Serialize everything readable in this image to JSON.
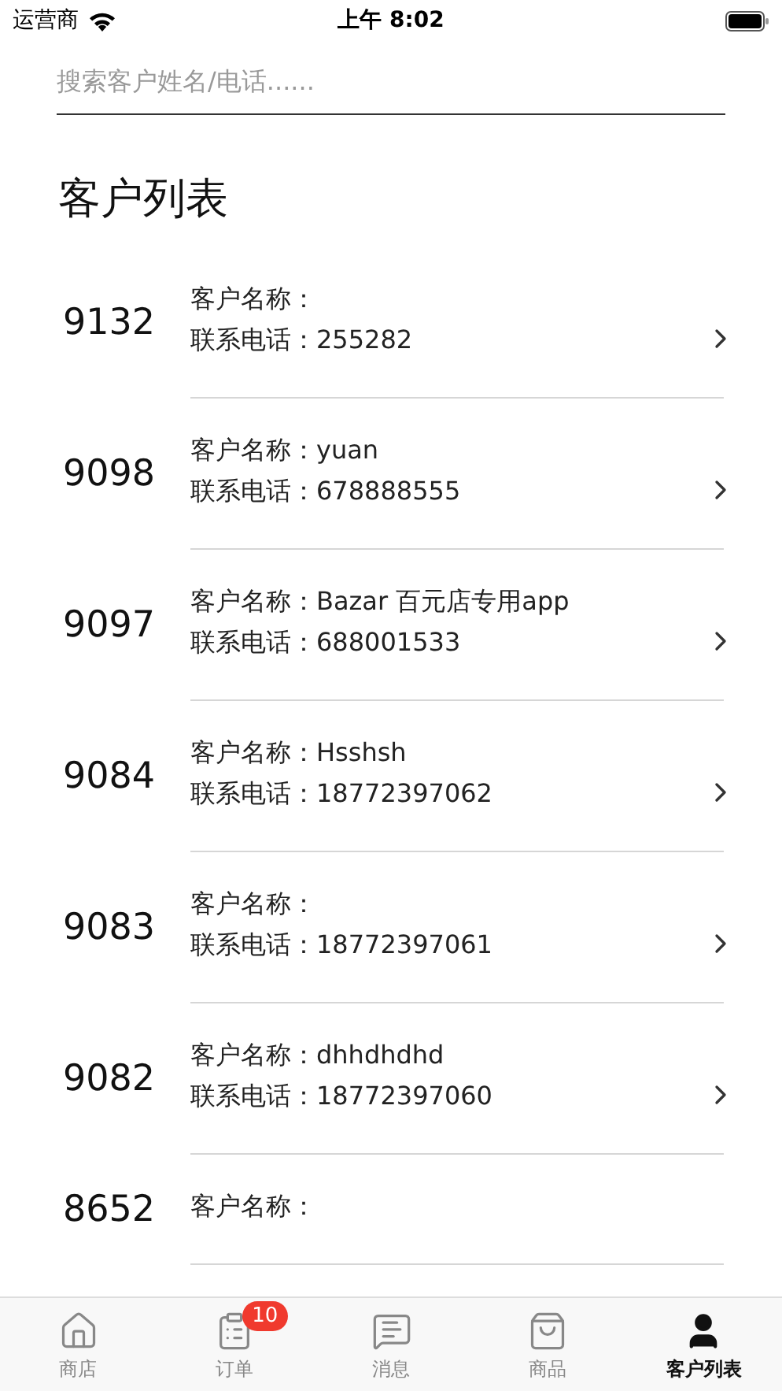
{
  "status_bar": {
    "carrier": "运营商",
    "time": "上午 8:02"
  },
  "search": {
    "placeholder": "搜索客户姓名/电话......"
  },
  "title": "客户列表",
  "customers": [
    {
      "id": "9132",
      "name_line": "客户名称：",
      "phone_line": "联系电话：255282"
    },
    {
      "id": "9098",
      "name_line": "客户名称：yuan",
      "phone_line": "联系电话：678888555"
    },
    {
      "id": "9097",
      "name_line": "客户名称：Bazar 百元店专用app",
      "phone_line": "联系电话：688001533"
    },
    {
      "id": "9084",
      "name_line": "客户名称：Hsshsh",
      "phone_line": "联系电话：18772397062"
    },
    {
      "id": "9083",
      "name_line": "客户名称：",
      "phone_line": "联系电话：18772397061"
    },
    {
      "id": "9082",
      "name_line": "客户名称：dhhdhdhd",
      "phone_line": "联系电话：18772397060"
    },
    {
      "id": "8652",
      "name_line": "客户名称："
    }
  ],
  "tab_bar": [
    {
      "kind": "store",
      "label": "商店",
      "selected": false
    },
    {
      "kind": "orders",
      "label": "订单",
      "selected": false,
      "badge": "10"
    },
    {
      "kind": "messages",
      "label": "消息",
      "selected": false
    },
    {
      "kind": "products",
      "label": "商品",
      "selected": false
    },
    {
      "kind": "customers",
      "label": "客户列表",
      "selected": true
    }
  ]
}
